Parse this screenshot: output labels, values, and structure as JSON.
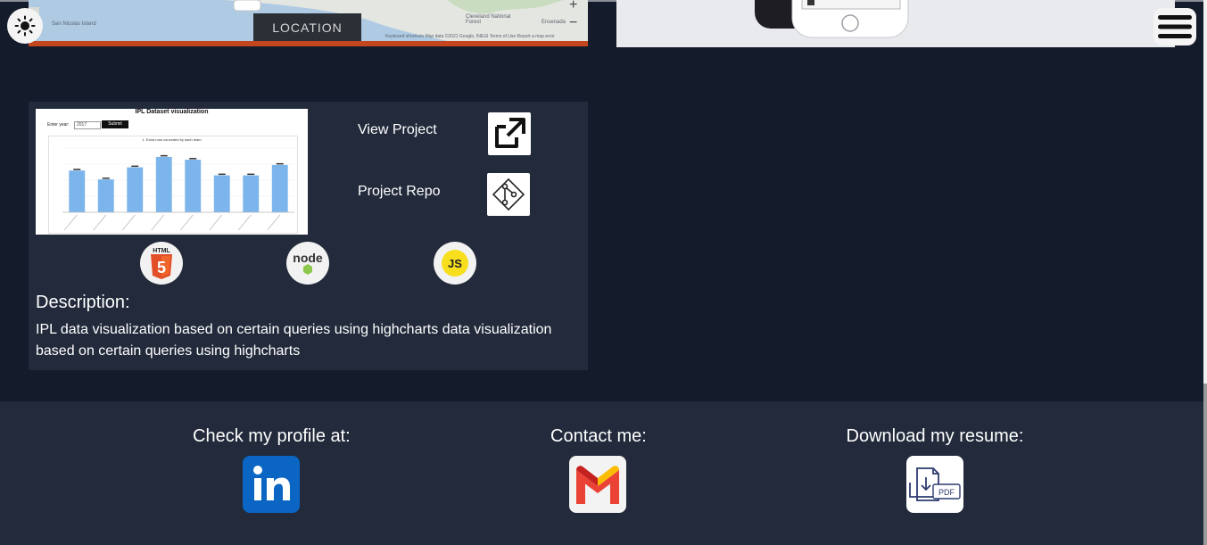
{
  "map_preview": {
    "location_label": "LOCATION",
    "place_labels": [
      "San Nicolas Island",
      "Cleveland National Forest",
      "Ensenada"
    ],
    "attribution": "Keyboard shortcuts  Map data ©2021 Google, INEGI  Terms of Use  Report a map error"
  },
  "project": {
    "thumbnail": {
      "title": "IPL Dataset visualization",
      "input_label": "Enter year:",
      "input_value": "2017",
      "submit_label": "Submit",
      "chart_title": "1. Extra runs conceded by each team"
    },
    "links": {
      "view_label": "View Project",
      "repo_label": "Project Repo"
    },
    "tech_stack": [
      {
        "name": "html5-icon",
        "badge": "HTML"
      },
      {
        "name": "nodejs-icon",
        "badge": "node"
      },
      {
        "name": "javascript-icon",
        "badge": "JS"
      }
    ],
    "description_title": "Description:",
    "description": "IPL data visualization based on certain queries using highcharts data visualization based on certain queries using highcharts"
  },
  "footer": {
    "profile_label": "Check my profile at:",
    "contact_label": "Contact me:",
    "resume_label": "Download my resume:",
    "pdf_text": "PDF"
  },
  "colors": {
    "page_bg": "#141b2b",
    "card_bg": "#222a3b",
    "linkedin": "#0a66c2",
    "gmail_red": "#ea4335",
    "map_bar": "#c4461e"
  },
  "chart_data": {
    "type": "bar",
    "title": "1. Extra runs conceded by each team",
    "categories": [
      "",
      "",
      "",
      "",
      "",
      "",
      "",
      ""
    ],
    "values": [
      104,
      82,
      112,
      138,
      131,
      92,
      92,
      118
    ],
    "ylim": [
      0,
      160
    ]
  }
}
